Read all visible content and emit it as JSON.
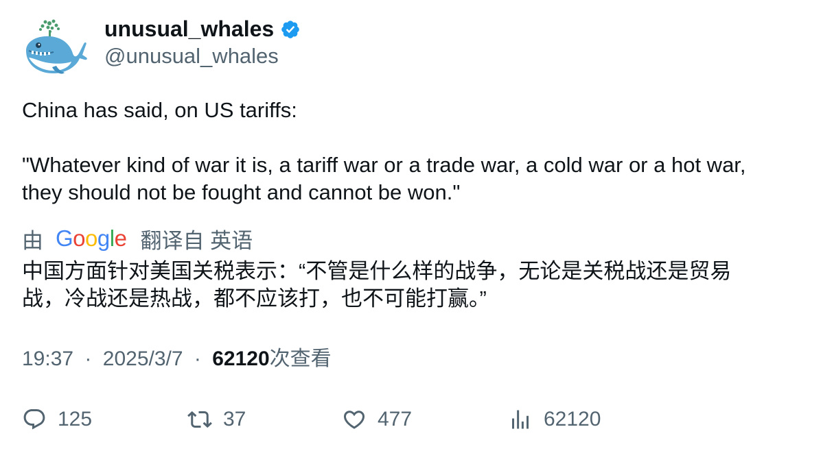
{
  "author": {
    "display_name": "unusual_whales",
    "handle": "@unusual_whales",
    "verified": true,
    "verified_color": "#1d9bf0"
  },
  "tweet": {
    "lines": [
      "China has said, on US tariffs:",
      "\"Whatever kind of war it is, a tariff war or a trade war, a cold war or a hot war,",
      "they should not be fought and cannot be won.\""
    ]
  },
  "translation": {
    "by_label": "由",
    "provider": "Google",
    "from_label": "翻译自 英语",
    "text_lines": [
      "中国方面针对美国关税表示：“不管是什么样的战争，无论是关税战还是贸易",
      "战，冷战还是热战，都不应该打，也不可能打赢。”"
    ]
  },
  "meta": {
    "time": "19:37",
    "separator": "·",
    "date": "2025/3/7",
    "views_count": "62120",
    "views_label": "次查看"
  },
  "actions": {
    "reply_count": "125",
    "retweet_count": "37",
    "like_count": "477",
    "views_count": "62120"
  },
  "colors": {
    "text_primary": "#0f1419",
    "text_secondary": "#536471",
    "google_blue": "#4285F4",
    "google_red": "#EA4335",
    "google_yellow": "#FBBC05",
    "google_green": "#34A853"
  },
  "icons": {
    "avatar": "whale-avatar-icon",
    "verified": "verified-badge-icon",
    "reply": "reply-icon",
    "retweet": "retweet-icon",
    "like": "heart-icon",
    "views": "views-chart-icon"
  }
}
